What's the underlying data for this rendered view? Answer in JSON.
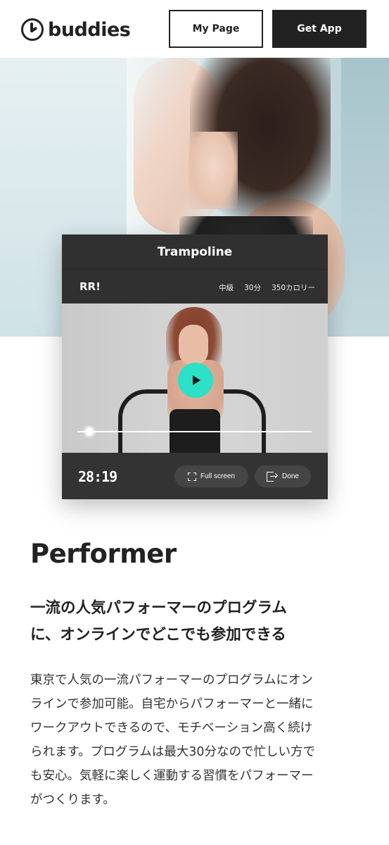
{
  "header": {
    "logo_text": "buddies",
    "mypage_label": "My Page",
    "getapp_label": "Get App"
  },
  "player": {
    "title": "Trampoline",
    "program_name": "RR!",
    "level": "中級",
    "duration": "30分",
    "calories": "350カロリー",
    "progress": 0.05,
    "time": "28:19",
    "fullscreen_label": "Full screen",
    "done_label": "Done",
    "accent_color": "#2de0c8"
  },
  "section": {
    "title": "Performer",
    "lead_line1": "一流の人気パフォーマーのプログラム",
    "lead_line2": "に、オンラインでどこでも参加できる",
    "body_lines": [
      "東京で人気の一流パフォーマーのプログラムにオン",
      "ラインで参加可能。自宅からパフォーマーと一緒に",
      "ワークアウトできるので、モチベーション高く続け",
      "られます。プログラムは最大30分なので忙しい方で",
      "も安心。気軽に楽しく運動する習慣をパフォーマー",
      "がつくります。"
    ]
  }
}
